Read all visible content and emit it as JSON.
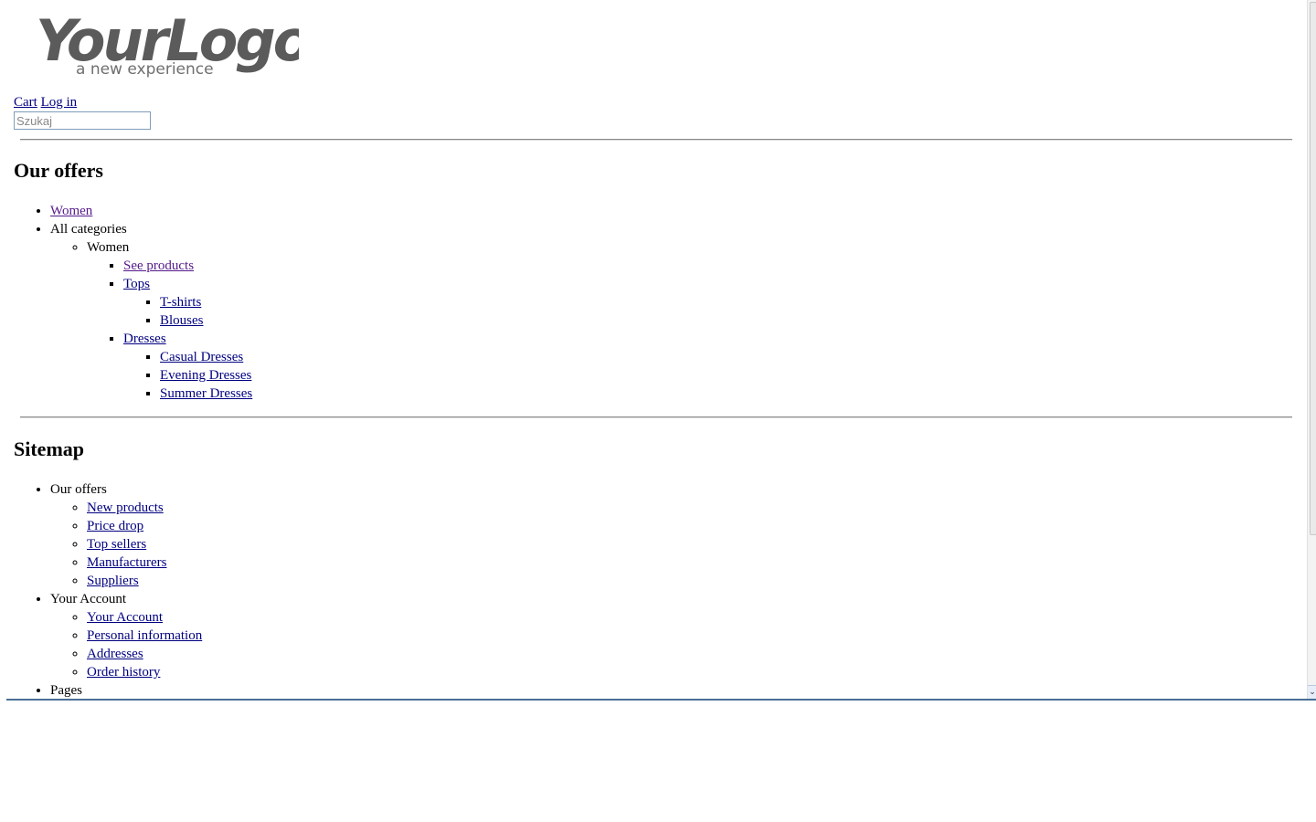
{
  "logo": {
    "main": "YourLogo",
    "tagline": "a new experience"
  },
  "header": {
    "cart_link": "Cart",
    "login_link": "Log in"
  },
  "search": {
    "placeholder": "Szukaj"
  },
  "offers": {
    "heading": "Our offers",
    "top_item_women": "Women",
    "all_categories": "All categories",
    "sub_women": "Women",
    "see_products": "See products",
    "tops": "Tops",
    "tops_children": [
      "T-shirts",
      "Blouses"
    ],
    "dresses": "Dresses",
    "dresses_children": [
      "Casual Dresses",
      "Evening Dresses",
      "Summer Dresses"
    ]
  },
  "sitemap": {
    "heading": "Sitemap",
    "our_offers": "Our offers",
    "offers_links": [
      "New products",
      "Price drop",
      "Top sellers",
      "Manufacturers",
      "Suppliers"
    ],
    "your_account": "Your Account",
    "account_links": [
      "Your Account",
      "Personal information",
      "Addresses",
      "Order history"
    ],
    "pages": "Pages"
  },
  "colors": {
    "link": "#000080",
    "visited_link": "#551a8b",
    "frame_border": "#4a6f97"
  },
  "icons": {
    "scroll_down": "chevron-down-icon"
  }
}
